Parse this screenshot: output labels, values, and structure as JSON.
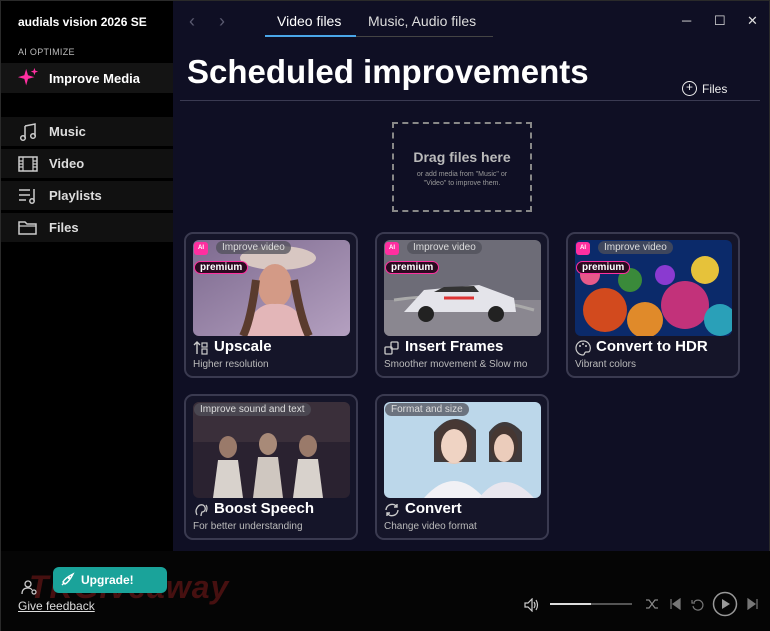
{
  "app": {
    "title": "audials vision 2026 SE"
  },
  "sidebar": {
    "section_label": "AI OPTIMIZE",
    "improve_label": "Improve Media",
    "items": [
      {
        "label": "Music",
        "icon": "music-note-icon"
      },
      {
        "label": "Video",
        "icon": "film-icon"
      },
      {
        "label": "Playlists",
        "icon": "playlist-icon"
      },
      {
        "label": "Files",
        "icon": "folder-icon"
      }
    ]
  },
  "tabs": [
    {
      "label": "Video files",
      "active": true
    },
    {
      "label": "Music, Audio files",
      "active": false
    }
  ],
  "main": {
    "title": "Scheduled improvements",
    "files_button": "Files",
    "dropzone": {
      "title": "Drag files here",
      "subtitle": "or add media from \"Music\" or \"Video\" to improve them."
    }
  },
  "cards": [
    {
      "pill": "Improve video",
      "ai": "AI",
      "premium": "premium",
      "title": "Upscale",
      "subtitle": "Higher resolution",
      "icon": "upscale-icon"
    },
    {
      "pill": "Improve video",
      "ai": "AI",
      "premium": "premium",
      "title": "Insert Frames",
      "subtitle": "Smoother movement & Slow mo",
      "icon": "frames-icon"
    },
    {
      "pill": "Improve video",
      "ai": "AI",
      "premium": "premium",
      "title": "Convert to HDR",
      "subtitle": "Vibrant colors",
      "icon": "palette-icon"
    },
    {
      "pill": "Improve sound and text",
      "title": "Boost Speech",
      "subtitle": "For better understanding",
      "icon": "speech-icon"
    },
    {
      "pill": "Format and size",
      "title": "Convert",
      "subtitle": "Change video format",
      "icon": "convert-icon"
    }
  ],
  "bottom": {
    "upgrade_label": "Upgrade!",
    "feedback_label": "Give feedback",
    "watermark": "TKGiveaway",
    "volume_level": 0.5
  },
  "colors": {
    "accent": "#4aa6e8",
    "premium": "#ff2fa0",
    "upgrade": "#1aa39a",
    "main_bg": "#0f0f24"
  }
}
